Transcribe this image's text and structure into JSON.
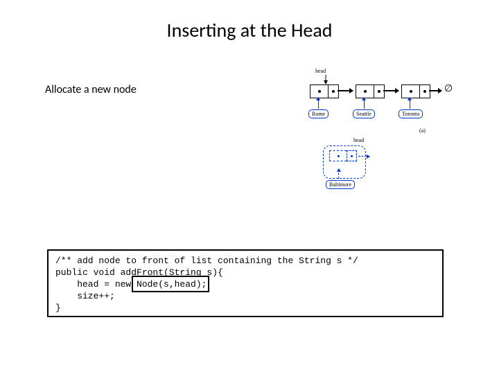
{
  "title": "Inserting at the Head",
  "step": "Allocate a new node",
  "diagramA": {
    "headLabel": "head",
    "nodes": [
      "Rome",
      "Seattle",
      "Toronto"
    ],
    "nullSymbol": "∅",
    "caption": "(a)"
  },
  "diagramB": {
    "headLabel": "head",
    "newNodeLabel": "Baltimore"
  },
  "code": {
    "line1": "/** add node to front of list containing the String s */",
    "line2": "public void addFront(String s){",
    "line3": "    head = new Node(s,head);",
    "line4": "    size++;",
    "line5": "}"
  }
}
